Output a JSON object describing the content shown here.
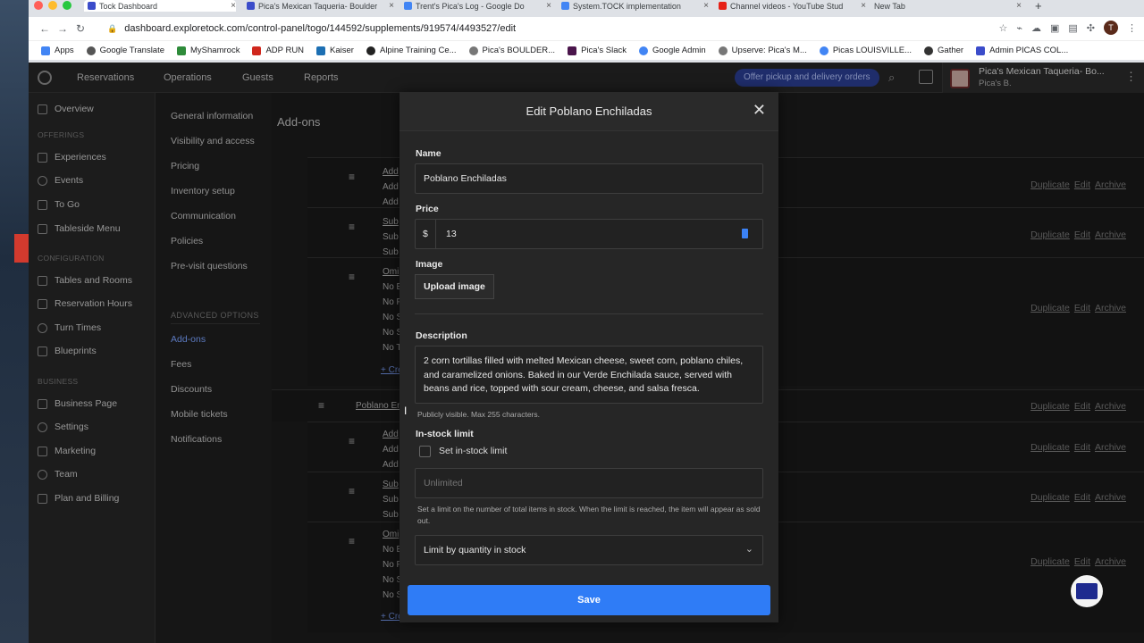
{
  "browser": {
    "tabs": [
      {
        "label": "Tock Dashboard",
        "color": "#3b4cca"
      },
      {
        "label": "Pica's Mexican Taqueria- Boulder",
        "color": "#3b4cca"
      },
      {
        "label": "Trent's Pica's Log - Google Do",
        "color": "#4285f4"
      },
      {
        "label": "System.TOCK implementation",
        "color": "#4285f4"
      },
      {
        "label": "Channel videos - YouTube Stud",
        "color": "#e62117"
      },
      {
        "label": "New Tab",
        "color": "#dee1e6"
      }
    ],
    "url": "dashboard.exploretock.com/control-panel/togo/144592/supplements/919574/4493527/edit",
    "avatar_letter": "T",
    "bookmarks": [
      "Apps",
      "Google Translate",
      "MyShamrock",
      "ADP RUN",
      "Kaiser",
      "Alpine Training Ce...",
      "Pica's BOULDER...",
      "Pica's Slack",
      "Google Admin",
      "Upserve: Pica's M...",
      "Picas LOUISVILLE...",
      "Gather",
      "Admin PICAS COL..."
    ]
  },
  "topnav": {
    "items": [
      "Reservations",
      "Operations",
      "Guests",
      "Reports"
    ],
    "offer": "Offer pickup and delivery orders",
    "business_name": "Pica's Mexican Taqueria- Bo...",
    "business_sub": "Pica's B."
  },
  "sidebar": {
    "overview": "Overview",
    "offerings_header": "OFFERINGS",
    "offerings": [
      "Experiences",
      "Events",
      "To Go",
      "Tableside Menu"
    ],
    "configuration_header": "CONFIGURATION",
    "configuration": [
      "Tables and Rooms",
      "Reservation Hours",
      "Turn Times",
      "Blueprints"
    ],
    "business_header": "BUSINESS",
    "business": [
      "Business Page",
      "Settings",
      "Marketing",
      "Team",
      "Plan and Billing"
    ]
  },
  "subnav": {
    "items": [
      "General information",
      "Visibility and access",
      "Pricing",
      "Inventory setup",
      "Communication",
      "Policies",
      "Pre-visit questions"
    ],
    "advanced_header": "ADVANCED OPTIONS",
    "advanced": [
      "Add-ons",
      "Fees",
      "Discounts",
      "Mobile tickets",
      "Notifications"
    ]
  },
  "main": {
    "title": "Add-ons",
    "rows": [
      {
        "lines": [
          "Add",
          "Add",
          "Add"
        ]
      },
      {
        "lines": [
          "Sub",
          "Sub",
          "Sub"
        ]
      },
      {
        "lines": [
          "Omi",
          "No E",
          "No F",
          "No S",
          "No S",
          "No T"
        ],
        "create": "+ Cre"
      },
      {
        "parent": "Poblano En"
      },
      {
        "lines": [
          "Add",
          "Add",
          "Add"
        ]
      },
      {
        "lines": [
          "Sub",
          "Sub",
          "Sub"
        ]
      },
      {
        "lines": [
          "Omi",
          "No E",
          "No F",
          "No S",
          "No S"
        ],
        "create": "+ Cre"
      }
    ],
    "actions": {
      "duplicate": "Duplicate",
      "edit": "Edit",
      "archive": "Archive"
    }
  },
  "modal": {
    "title": "Edit Poblano Enchiladas",
    "name_label": "Name",
    "name_value": "Poblano Enchiladas",
    "price_label": "Price",
    "currency": "$",
    "price_value": "13",
    "image_label": "Image",
    "upload_label": "Upload image",
    "description_label": "Description",
    "description_value": "2 corn tortillas filled with melted Mexican cheese, sweet corn, poblano chiles, and caramelized onions.  Baked in our Verde Enchilada sauce,  served with beans and rice, topped with sour cream, cheese, and salsa fresca.",
    "description_hint": "Publicly visible. Max 255 characters.",
    "stock_label": "In-stock limit",
    "stock_checkbox": "Set in-stock limit",
    "stock_placeholder": "Unlimited",
    "stock_hint": "Set a limit on the number of total items in stock. When the limit is reached, the item will appear as sold out.",
    "limit_select": "Limit by quantity in stock",
    "save_label": "Save"
  }
}
